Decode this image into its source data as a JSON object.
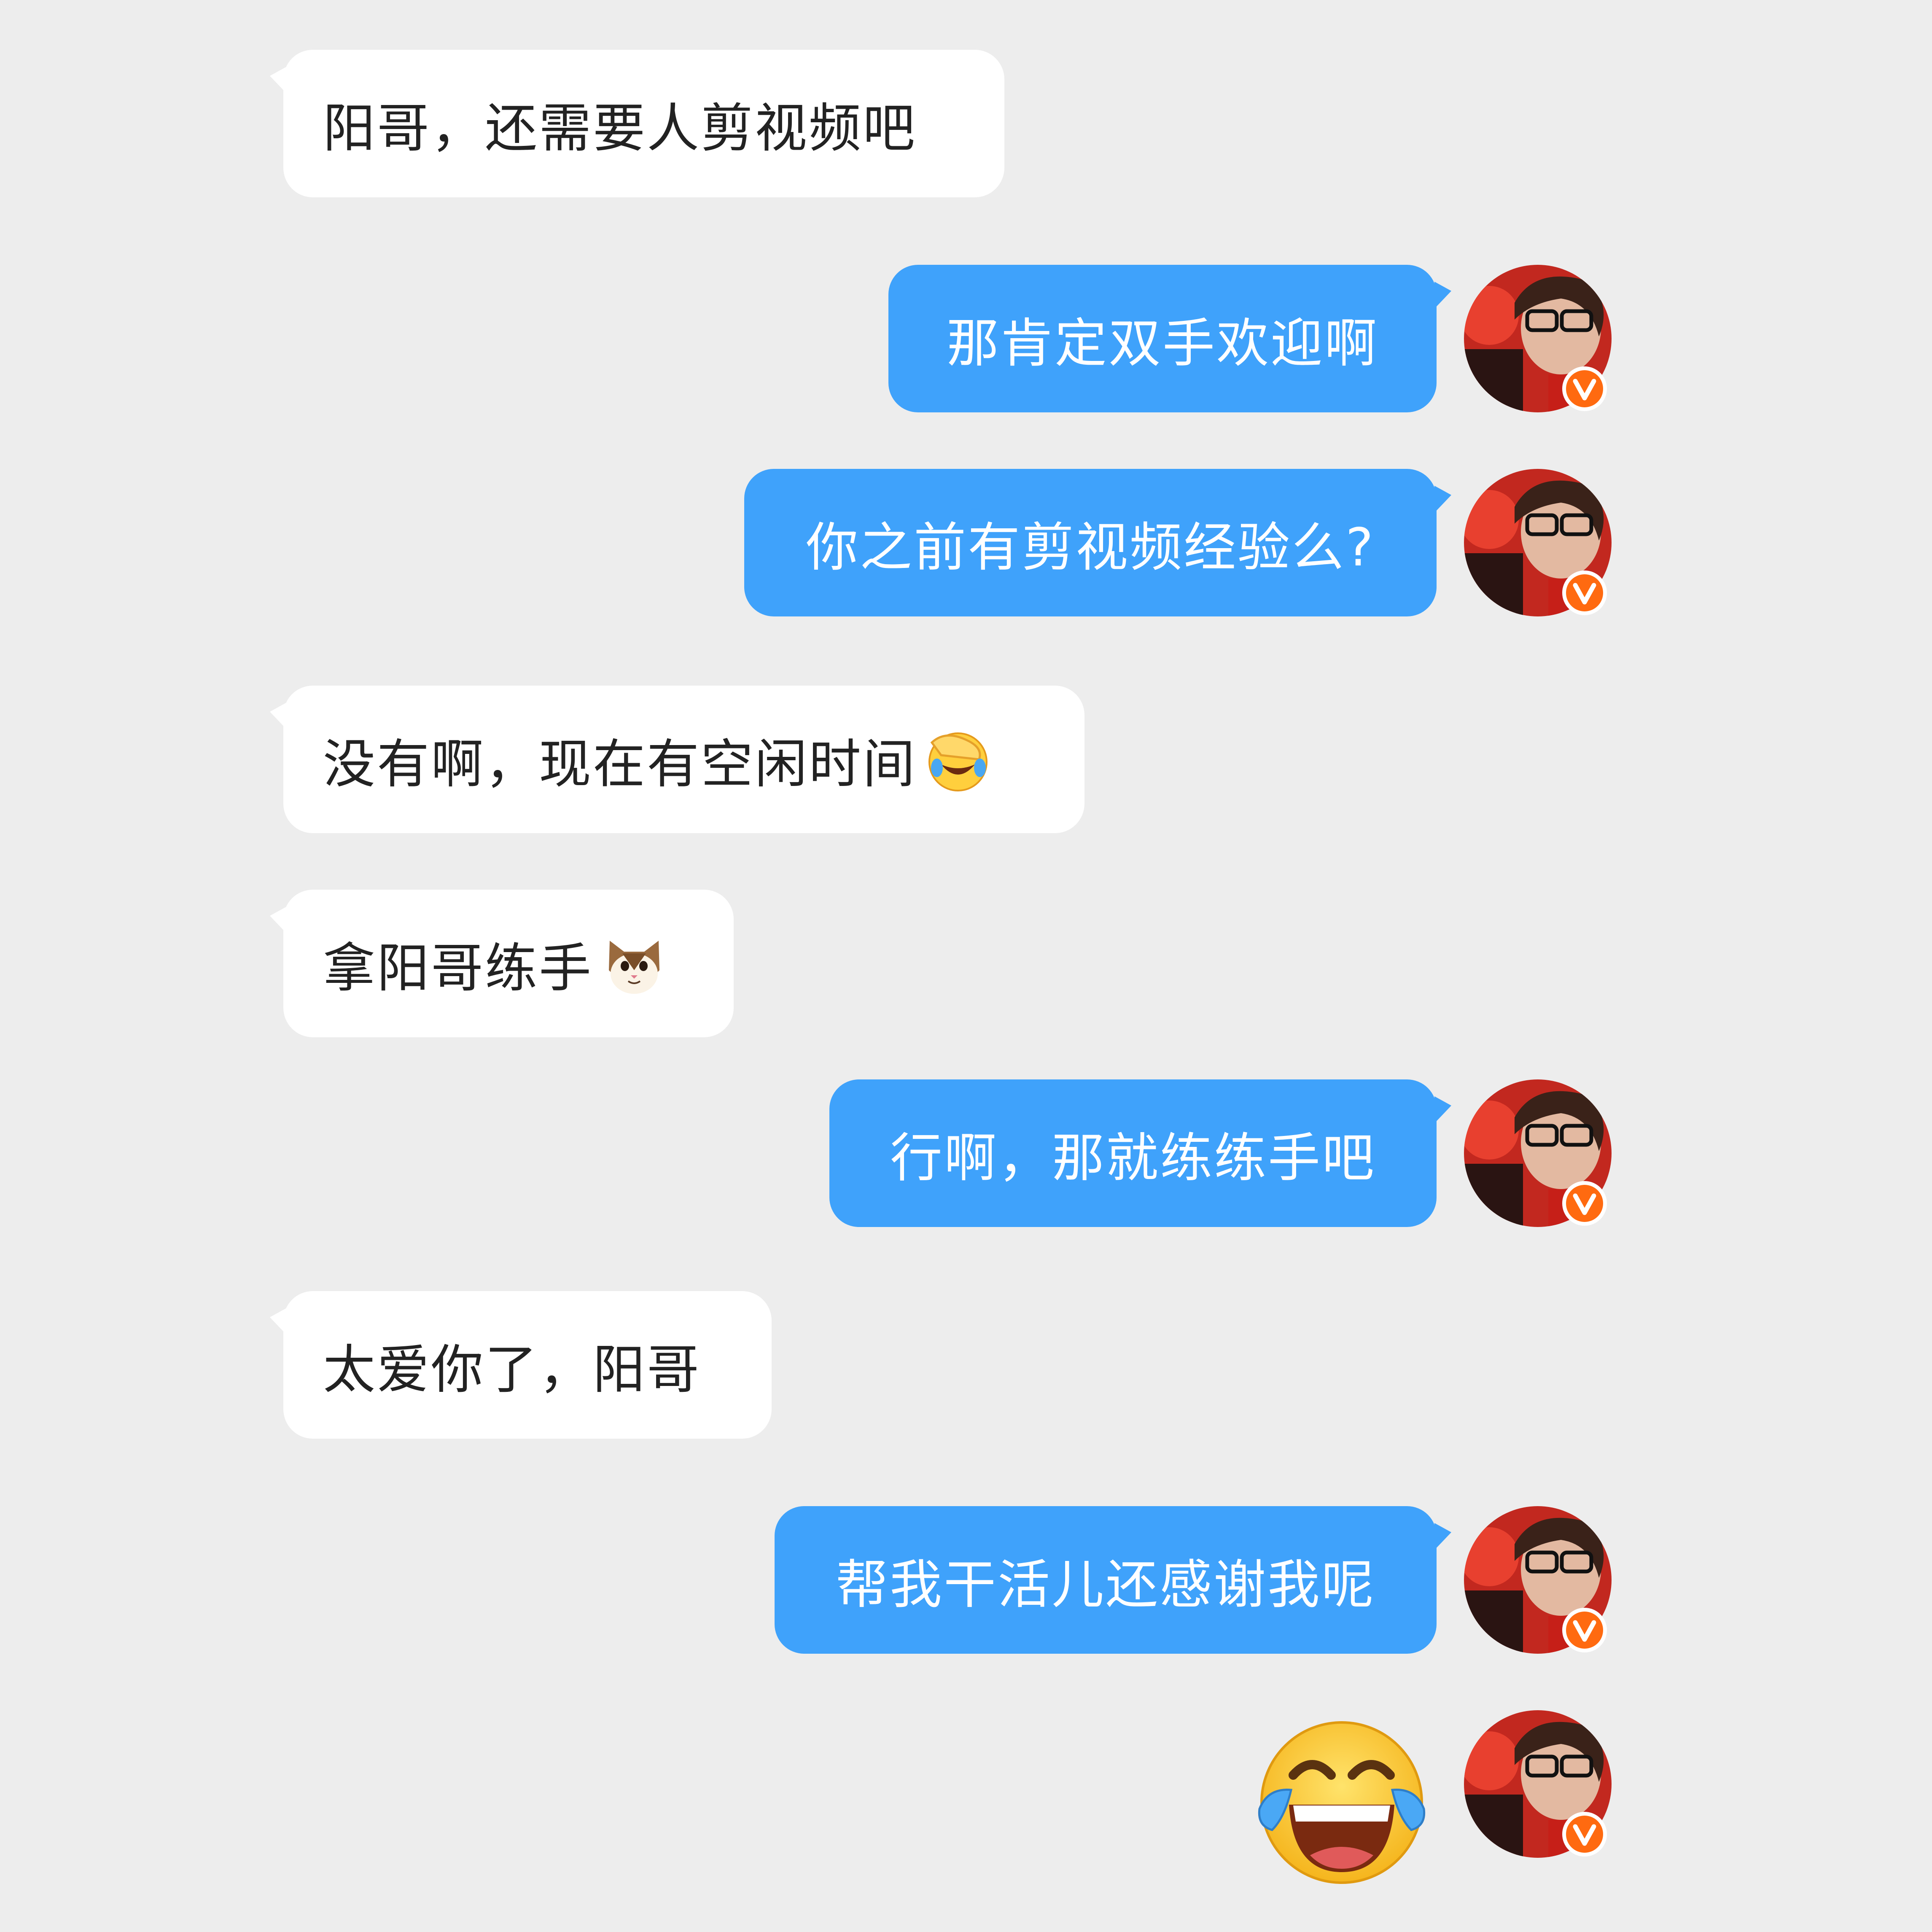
{
  "colors": {
    "background": "#ededed",
    "incoming_bubble": "#ffffff",
    "outgoing_bubble": "#3fa2fb",
    "badge": "#ff6a10"
  },
  "messages": [
    {
      "side": "incoming",
      "text": "阳哥，还需要人剪视频吧"
    },
    {
      "side": "outgoing",
      "text": "那肯定双手欢迎啊",
      "badge": "v"
    },
    {
      "side": "outgoing",
      "text": "你之前有剪视频经验么?",
      "badge": "v"
    },
    {
      "side": "incoming",
      "text": "没有啊，现在有空闲时间",
      "emoji": "facepalm-laughing-emoji"
    },
    {
      "side": "incoming",
      "text": "拿阳哥练手",
      "emoji": "cat-face-emoji"
    },
    {
      "side": "outgoing",
      "text": "行啊，那就练练手吧",
      "badge": "v"
    },
    {
      "side": "incoming",
      "text": "太爱你了，阳哥"
    },
    {
      "side": "outgoing",
      "text": "帮我干活儿还感谢我呢",
      "badge": "v"
    },
    {
      "side": "outgoing",
      "emoji": "tears-of-joy-emoji",
      "badge": "v"
    }
  ]
}
